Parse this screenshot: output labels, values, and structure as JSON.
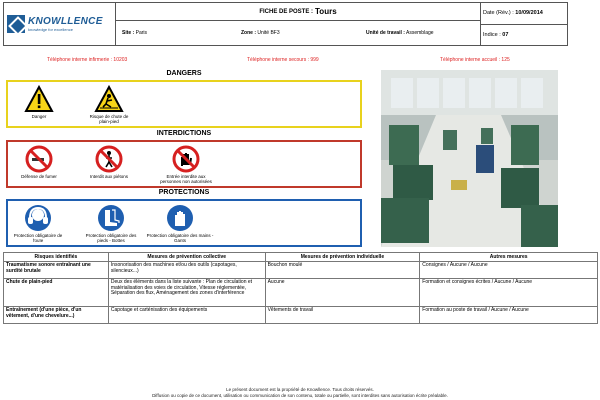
{
  "header": {
    "logo_name": "KNOWLLENCE",
    "logo_tagline": "knowledge for excellence",
    "doc_type": "FICHE DE POSTE :",
    "post_name": "Tours",
    "site_label": "Site :",
    "site_value": "Paris",
    "zone_label": "Zone :",
    "zone_value": "Unité BF3",
    "unit_label": "Unité de travail :",
    "unit_value": "Assemblage",
    "date_label": "Date (Rév.) :",
    "date_value": "10/09/2014",
    "index_label": "Indice :",
    "index_value": "07"
  },
  "phones": {
    "infirmary": "Téléphone interne infirmerie : 10203",
    "rescue": "Téléphone interne secours : 999",
    "reception": "Téléphone interne accueil : 125"
  },
  "dangers": {
    "title": "DANGERS",
    "items": [
      "Danger",
      "Risque de chute de plain-pied"
    ]
  },
  "interdictions": {
    "title": "INTERDICTIONS",
    "items": [
      "Défense de fumer",
      "Interdit aux piétons",
      "Entrée interdite aux personnes non autorisées"
    ]
  },
  "protections": {
    "title": "PROTECTIONS",
    "items": [
      "Protection obligatoire de l'ouïe",
      "Protection obligatoire des pieds - Bottes",
      "Protection obligatoire des mains - Gants"
    ]
  },
  "table": {
    "headers": [
      "Risques identifiés",
      "Mesures de prévention collective",
      "Mesures de prévention individuelle",
      "Autres mesures"
    ],
    "rows": [
      [
        "Traumatisme sonore entraînant une surdité brutale",
        "Insonorisation des machines et/ou des outils (capotages, silencieux...)",
        "Bouchon moulé",
        "Consignes / Aucune / Aucune"
      ],
      [
        "Chute de plain-pied",
        "Deux des éléments dans la liste suivante : Plan de circulation et matérialisation des voies de circulation, Vitesse réglementée, Séparation des flux, Aménagement des zones d'interférence",
        "Aucune",
        "Formation et consignes écrites / Aucune / Aucune"
      ],
      [
        "Entraînement (d'une pièce, d'un vêtement, d'une chevelure...)",
        "Capotage et carténisation des équipements",
        "Vêtements de travail",
        "Formation au poste de travail / Aucune / Aucune"
      ]
    ]
  },
  "footer": {
    "line1": "Le présent document est la propriété de Knowllence. Tous droits réservés.",
    "line2": "Diffusion ou copie de ce document, utilisation ou communication de son contenu, totale ou partielle, sont interdites sans autorisation écrite préalable."
  },
  "colors": {
    "danger_border": "#e8d21d",
    "interdiction_border": "#c0392b",
    "protection_border": "#1f5fb0",
    "phone_text": "#d22222",
    "brand": "#1f5d96"
  }
}
